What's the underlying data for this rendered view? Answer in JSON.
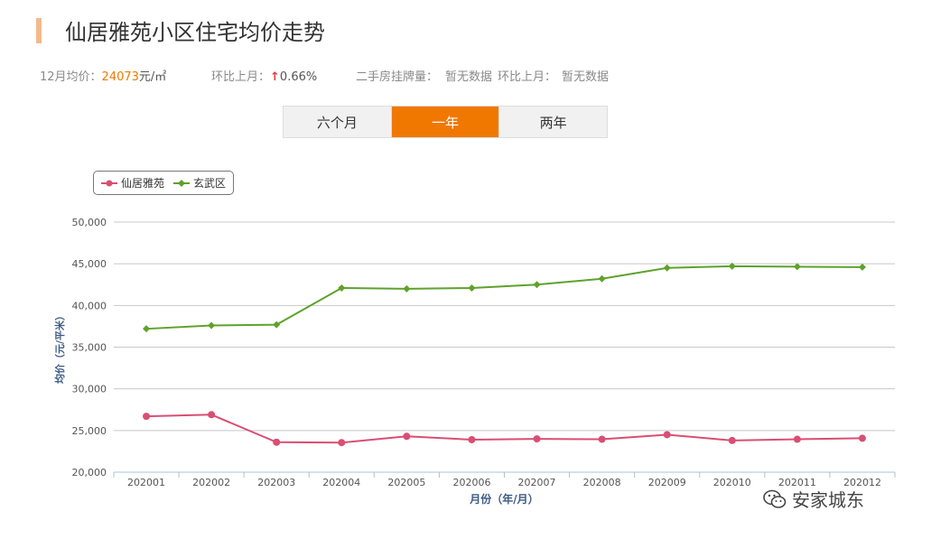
{
  "header": {
    "title": "仙居雅苑小区住宅均价走势"
  },
  "stats": {
    "price_label": "12月均价：",
    "price_value": "24073",
    "price_unit": "元/㎡",
    "mom_label": "环比上月：",
    "mom_arrow": "↑",
    "mom_value": "0.66%",
    "listing_label": "二手房挂牌量：",
    "listing_value": "暂无数据",
    "listing_mom_label": "环比上月：",
    "listing_mom_value": "暂无数据"
  },
  "tabs": [
    {
      "label": "六个月",
      "active": false
    },
    {
      "label": "一年",
      "active": true
    },
    {
      "label": "两年",
      "active": false
    }
  ],
  "colors": {
    "accent": "#f07800",
    "series_1": "#d94e74",
    "series_2": "#5ea22b"
  },
  "chart_data": {
    "type": "line",
    "x": [
      "202001",
      "202002",
      "202003",
      "202004",
      "202005",
      "202006",
      "202007",
      "202008",
      "202009",
      "202010",
      "202011",
      "202012"
    ],
    "series": [
      {
        "name": "仙居雅苑",
        "color": "#d94e74",
        "marker": "circle",
        "values": [
          26700,
          26900,
          23600,
          23550,
          24300,
          23900,
          24000,
          23950,
          24500,
          23800,
          23950,
          24073
        ]
      },
      {
        "name": "玄武区",
        "color": "#5ea22b",
        "marker": "diamond",
        "values": [
          37200,
          37600,
          37700,
          42100,
          42000,
          42100,
          42500,
          43200,
          44500,
          44700,
          44650,
          44600
        ]
      }
    ],
    "xlabel": "月份（年/月）",
    "ylabel": "均价（元/平米）",
    "ylim": [
      20000,
      50000
    ],
    "yticks": [
      "20,000",
      "25,000",
      "30,000",
      "35,000",
      "40,000",
      "45,000",
      "50,000"
    ],
    "grid": true,
    "legend": "top-left"
  },
  "watermark": {
    "icon": "wechat-icon",
    "text": "安家城东"
  }
}
